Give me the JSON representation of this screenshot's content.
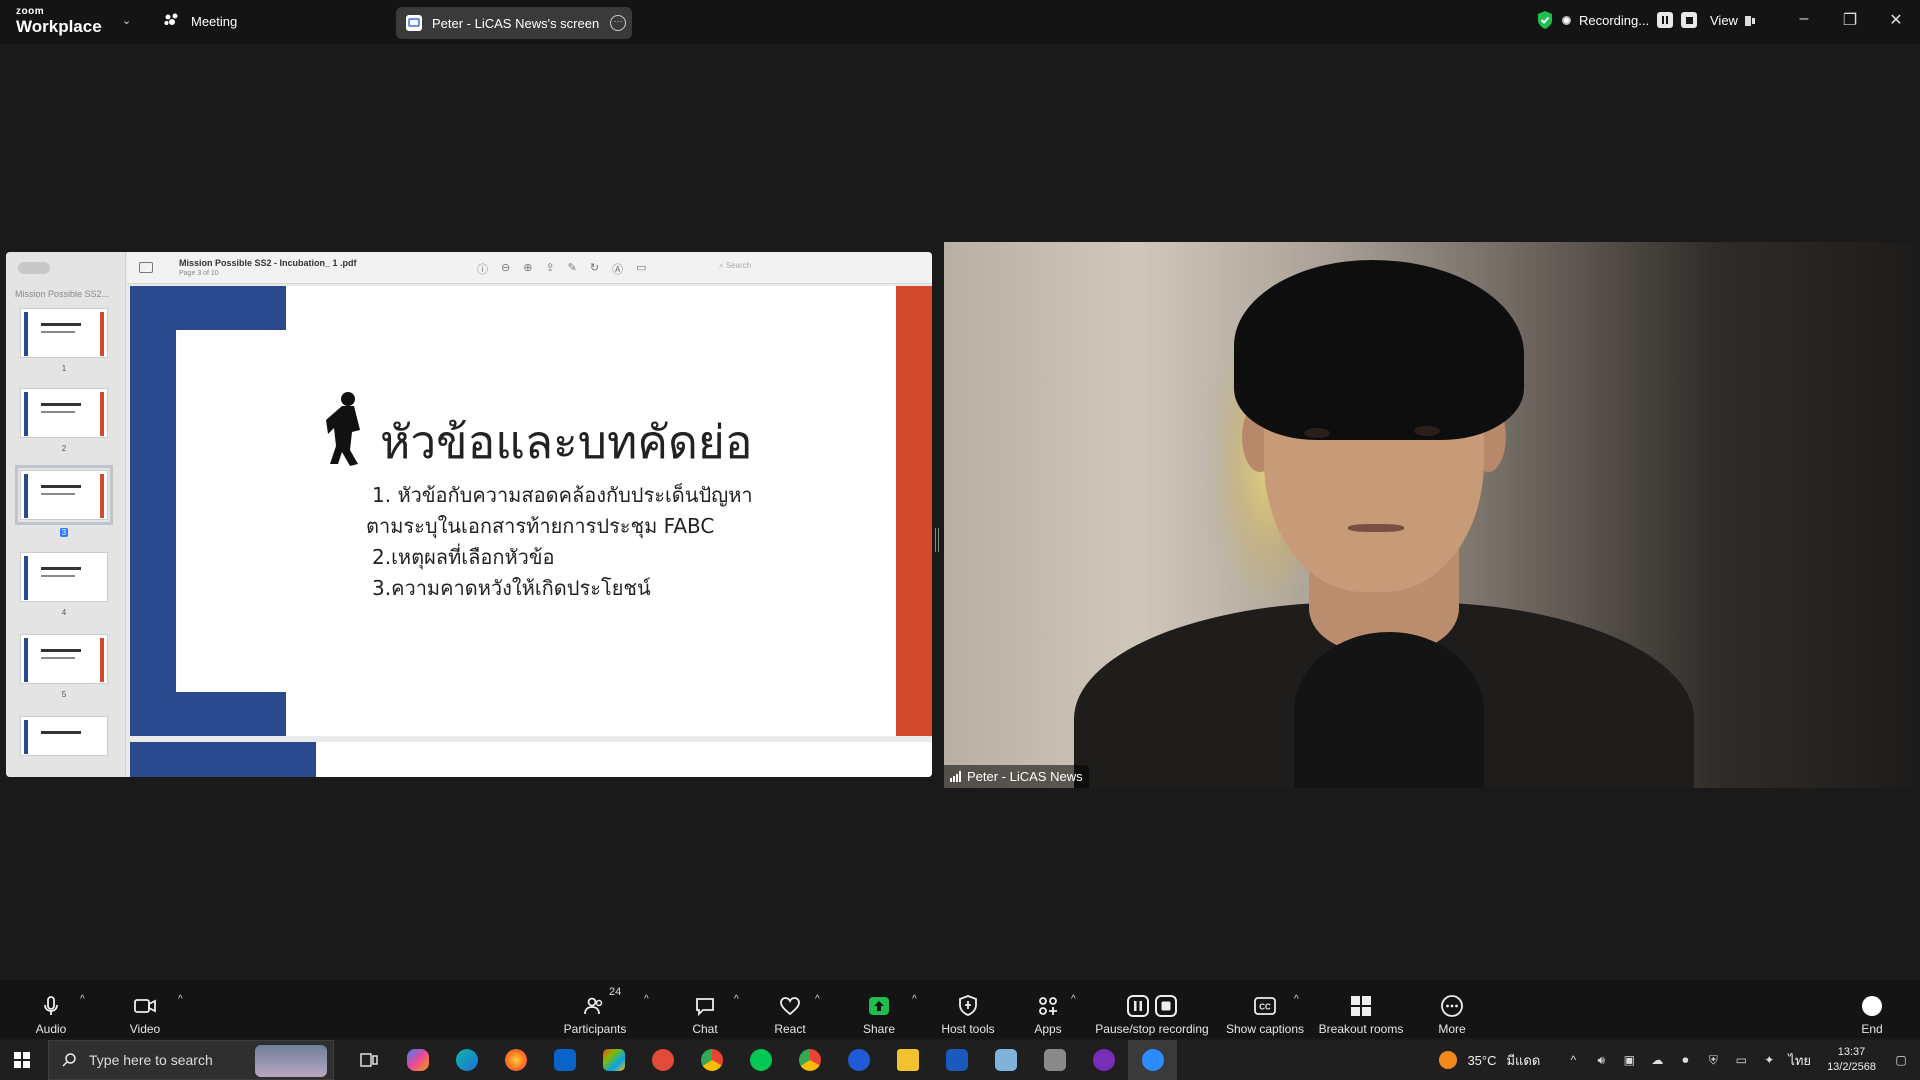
{
  "topbar": {
    "logo_small": "zoom",
    "logo_big": "Workplace",
    "meeting_label": "Meeting",
    "share_tab_label": "Peter - LiCAS News's screen",
    "recording_label": "Recording...",
    "view_label": "View"
  },
  "share": {
    "sidebar_title": "Mission Possible SS2...",
    "doc_title": "Mission Possible SS2 - Incubation_ 1 .pdf",
    "doc_subtitle": "Page 3 of 10",
    "search_placeholder": "Search",
    "thumbnails": [
      {
        "num": "1"
      },
      {
        "num": "2"
      },
      {
        "num": "3"
      },
      {
        "num": "4"
      },
      {
        "num": "5"
      }
    ],
    "slide": {
      "heading": "หัวข้อและบทคัดย่อ",
      "line1": "1. หัวข้อกับความสอดคล้องกับประเด็นปัญหา",
      "line2": "ตามระบุในเอกสารท้ายการประชุม FABC",
      "line3": "2.เหตุผลที่เลือกหัวข้อ",
      "line4": "3.ความคาดหวังให้เกิดประโยชน์"
    }
  },
  "video": {
    "participant_name": "Peter - LiCAS News"
  },
  "toolbar": {
    "audio": "Audio",
    "video": "Video",
    "participants": "Participants",
    "participants_count": "24",
    "chat": "Chat",
    "react": "React",
    "share": "Share",
    "host_tools": "Host tools",
    "apps": "Apps",
    "pause_stop": "Pause/stop recording",
    "captions": "Show captions",
    "breakout": "Breakout rooms",
    "more": "More",
    "end": "End"
  },
  "taskbar": {
    "search_placeholder": "Type here to search",
    "weather": "35°C",
    "weather_desc": "มีแดด",
    "ime": "ไทย",
    "time": "13:37",
    "date": "13/2/2568"
  },
  "colors": {
    "slide_blue": "#2b4a8e",
    "slide_red": "#d24a2e",
    "share_green": "#1fbf4f",
    "end_red": "#e0292f"
  }
}
